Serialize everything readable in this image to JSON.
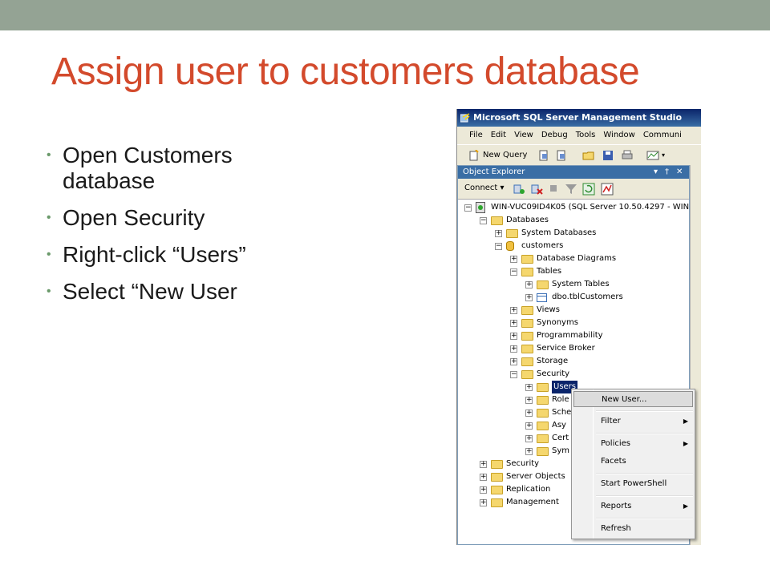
{
  "slide": {
    "title": "Assign user to customers database",
    "bullets": [
      "Open Customers database",
      "Open Security",
      "Right-click “Users”",
      "Select “New User"
    ]
  },
  "window": {
    "title": "Microsoft SQL Server Management Studio",
    "menu": [
      "File",
      "Edit",
      "View",
      "Debug",
      "Tools",
      "Window",
      "Communi"
    ],
    "toolbar_new_query": "New Query"
  },
  "object_explorer": {
    "header": "Object Explorer",
    "header_buttons": [
      "▾",
      "†",
      "✕"
    ],
    "connect_label": "Connect ▾",
    "tree": [
      {
        "label": "WIN-VUC09ID4K05 (SQL Server 10.50.4297 - WIN",
        "icon": "server",
        "exp": "−",
        "level": 0
      },
      {
        "label": "Databases",
        "icon": "folder",
        "exp": "−",
        "level": 1
      },
      {
        "label": "System Databases",
        "icon": "folder",
        "exp": "+",
        "level": 2
      },
      {
        "label": "customers",
        "icon": "db",
        "exp": "−",
        "level": 2
      },
      {
        "label": "Database Diagrams",
        "icon": "folder",
        "exp": "+",
        "level": 3
      },
      {
        "label": "Tables",
        "icon": "folder",
        "exp": "−",
        "level": 3
      },
      {
        "label": "System Tables",
        "icon": "folder",
        "exp": "+",
        "level": 4
      },
      {
        "label": "dbo.tblCustomers",
        "icon": "table",
        "exp": "+",
        "level": 4
      },
      {
        "label": "Views",
        "icon": "folder",
        "exp": "+",
        "level": 3
      },
      {
        "label": "Synonyms",
        "icon": "folder",
        "exp": "+",
        "level": 3
      },
      {
        "label": "Programmability",
        "icon": "folder",
        "exp": "+",
        "level": 3
      },
      {
        "label": "Service Broker",
        "icon": "folder",
        "exp": "+",
        "level": 3
      },
      {
        "label": "Storage",
        "icon": "folder",
        "exp": "+",
        "level": 3
      },
      {
        "label": "Security",
        "icon": "folder",
        "exp": "−",
        "level": 3
      },
      {
        "label": "Users",
        "icon": "folder",
        "exp": "+",
        "level": 4,
        "selected": true
      },
      {
        "label": "Role",
        "icon": "folder",
        "exp": "+",
        "level": 4
      },
      {
        "label": "Sche",
        "icon": "folder",
        "exp": "+",
        "level": 4
      },
      {
        "label": "Asy",
        "icon": "folder",
        "exp": "+",
        "level": 4
      },
      {
        "label": "Cert",
        "icon": "folder",
        "exp": "+",
        "level": 4
      },
      {
        "label": "Sym",
        "icon": "folder",
        "exp": "+",
        "level": 4
      },
      {
        "label": "Security",
        "icon": "folder",
        "exp": "+",
        "level": 1
      },
      {
        "label": "Server Objects",
        "icon": "folder",
        "exp": "+",
        "level": 1
      },
      {
        "label": "Replication",
        "icon": "folder",
        "exp": "+",
        "level": 1
      },
      {
        "label": "Management",
        "icon": "folder",
        "exp": "+",
        "level": 1
      }
    ]
  },
  "context_menu": {
    "items": [
      {
        "label": "New User...",
        "highlighted": true,
        "submenu": false
      },
      {
        "label": "Filter",
        "submenu": true
      },
      {
        "label": "Policies",
        "submenu": true
      },
      {
        "label": "Facets",
        "submenu": false
      },
      {
        "label": "Start PowerShell",
        "submenu": false
      },
      {
        "label": "Reports",
        "submenu": true
      },
      {
        "label": "Refresh",
        "submenu": false
      }
    ]
  },
  "colors": {
    "title": "#d34a2c",
    "band": "#94a394",
    "selection": "#0a246a"
  }
}
